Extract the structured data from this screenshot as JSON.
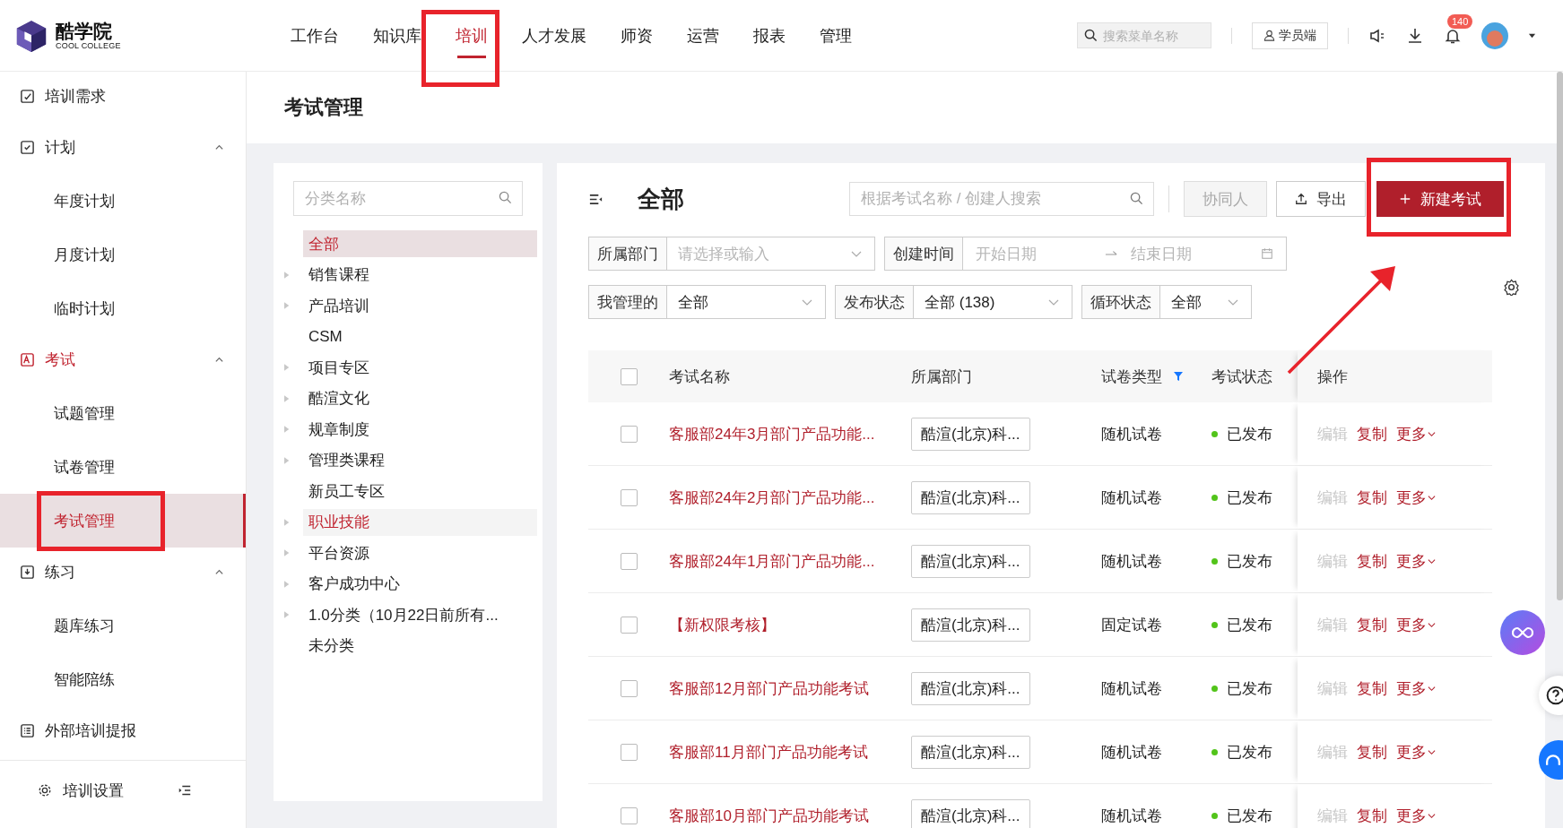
{
  "logo": {
    "name": "酷学院",
    "subtitle": "COOL COLLEGE"
  },
  "nav": [
    {
      "label": "工作台",
      "selected": false
    },
    {
      "label": "知识库",
      "selected": false
    },
    {
      "label": "培训",
      "selected": true
    },
    {
      "label": "人才发展",
      "selected": false
    },
    {
      "label": "师资",
      "selected": false
    },
    {
      "label": "运营",
      "selected": false
    },
    {
      "label": "报表",
      "selected": false
    },
    {
      "label": "管理",
      "selected": false
    }
  ],
  "menu_search": {
    "placeholder": "搜索菜单名称"
  },
  "student_button": "学员端",
  "notification_count": "140",
  "sidebar": {
    "items": [
      {
        "label": "培训需求"
      },
      {
        "label": "计划",
        "expanded": true,
        "children": [
          {
            "label": "年度计划",
            "selected": false
          },
          {
            "label": "月度计划",
            "selected": false
          },
          {
            "label": "临时计划",
            "selected": false
          }
        ]
      },
      {
        "label": "考试",
        "expanded": true,
        "children": [
          {
            "label": "试题管理",
            "selected": false
          },
          {
            "label": "试卷管理",
            "selected": false
          },
          {
            "label": "考试管理",
            "selected": true
          }
        ]
      },
      {
        "label": "练习",
        "expanded": true,
        "children": [
          {
            "label": "题库练习",
            "selected": false
          },
          {
            "label": "智能陪练",
            "selected": false
          }
        ]
      },
      {
        "label": "外部培训提报"
      }
    ],
    "footer": "培训设置"
  },
  "page_title": "考试管理",
  "categories": {
    "search_placeholder": "分类名称",
    "items": [
      {
        "label": "全部",
        "expandable": false,
        "selected": true,
        "hovered": false
      },
      {
        "label": "销售课程",
        "expandable": true,
        "selected": false,
        "hovered": false
      },
      {
        "label": "产品培训",
        "expandable": true,
        "selected": false,
        "hovered": false
      },
      {
        "label": "CSM",
        "expandable": false,
        "selected": false,
        "hovered": false
      },
      {
        "label": "项目专区",
        "expandable": true,
        "selected": false,
        "hovered": false
      },
      {
        "label": "酷渲文化",
        "expandable": true,
        "selected": false,
        "hovered": false
      },
      {
        "label": "规章制度",
        "expandable": true,
        "selected": false,
        "hovered": false
      },
      {
        "label": "管理类课程",
        "expandable": true,
        "selected": false,
        "hovered": false
      },
      {
        "label": "新员工专区",
        "expandable": false,
        "selected": false,
        "hovered": false
      },
      {
        "label": "职业技能",
        "expandable": true,
        "selected": false,
        "hovered": true
      },
      {
        "label": "平台资源",
        "expandable": true,
        "selected": false,
        "hovered": false
      },
      {
        "label": "客户成功中心",
        "expandable": true,
        "selected": false,
        "hovered": false
      },
      {
        "label": "1.0分类（10月22日前所有...",
        "expandable": true,
        "selected": false,
        "hovered": false
      },
      {
        "label": "未分类",
        "expandable": false,
        "selected": false,
        "hovered": false
      }
    ]
  },
  "main": {
    "title": "全部",
    "search_placeholder": "根据考试名称 / 创建人搜索",
    "buttons": [
      {
        "label": "协同人",
        "kind": "plain",
        "disabled": true
      },
      {
        "label": "导出",
        "kind": "export",
        "disabled": false
      },
      {
        "label": "新建考试",
        "kind": "primary",
        "disabled": false
      }
    ],
    "filter_rows": [
      [
        {
          "label": "所属部门",
          "kind": "select",
          "placeholder": "请选择或输入"
        },
        {
          "label": "创建时间",
          "kind": "daterange",
          "start_placeholder": "开始日期",
          "end_placeholder": "结束日期"
        }
      ],
      [
        {
          "label": "我管理的",
          "kind": "select",
          "value": "全部"
        },
        {
          "label": "发布状态",
          "kind": "select",
          "value": "全部 (138)"
        },
        {
          "label": "循环状态",
          "kind": "select",
          "value": "全部"
        }
      ]
    ]
  },
  "table": {
    "select_all_checked": false,
    "columns": [
      {
        "label": "考试名称",
        "filter": false
      },
      {
        "label": "所属部门",
        "filter": false
      },
      {
        "label": "试卷类型",
        "filter": true
      },
      {
        "label": "考试状态",
        "filter": false
      },
      {
        "label": "操作",
        "filter": false
      }
    ],
    "rows": [
      {
        "checked": false,
        "name": "客服部24年3月部门产品功能...",
        "department": "酷渲(北京)科...",
        "paper_type": "随机试卷",
        "status": "已发布",
        "color": "#52c41a",
        "actions": [
          {
            "label": "编辑",
            "disabled": true
          },
          {
            "label": "复制",
            "disabled": false
          },
          {
            "label": "更多",
            "disabled": false
          }
        ]
      },
      {
        "checked": false,
        "name": "客服部24年2月部门产品功能...",
        "department": "酷渲(北京)科...",
        "paper_type": "随机试卷",
        "status": "已发布",
        "color": "#52c41a",
        "actions": [
          {
            "label": "编辑",
            "disabled": true
          },
          {
            "label": "复制",
            "disabled": false
          },
          {
            "label": "更多",
            "disabled": false
          }
        ]
      },
      {
        "checked": false,
        "name": "客服部24年1月部门产品功能...",
        "department": "酷渲(北京)科...",
        "paper_type": "随机试卷",
        "status": "已发布",
        "color": "#52c41a",
        "actions": [
          {
            "label": "编辑",
            "disabled": true
          },
          {
            "label": "复制",
            "disabled": false
          },
          {
            "label": "更多",
            "disabled": false
          }
        ]
      },
      {
        "checked": false,
        "name": "【新权限考核】",
        "department": "酷渲(北京)科...",
        "paper_type": "固定试卷",
        "status": "已发布",
        "color": "#52c41a",
        "actions": [
          {
            "label": "编辑",
            "disabled": true
          },
          {
            "label": "复制",
            "disabled": false
          },
          {
            "label": "更多",
            "disabled": false
          }
        ]
      },
      {
        "checked": false,
        "name": "客服部12月部门产品功能考试",
        "department": "酷渲(北京)科...",
        "paper_type": "随机试卷",
        "status": "已发布",
        "color": "#52c41a",
        "actions": [
          {
            "label": "编辑",
            "disabled": true
          },
          {
            "label": "复制",
            "disabled": false
          },
          {
            "label": "更多",
            "disabled": false
          }
        ]
      },
      {
        "checked": false,
        "name": "客服部11月部门产品功能考试",
        "department": "酷渲(北京)科...",
        "paper_type": "随机试卷",
        "status": "已发布",
        "color": "#52c41a",
        "actions": [
          {
            "label": "编辑",
            "disabled": true
          },
          {
            "label": "复制",
            "disabled": false
          },
          {
            "label": "更多",
            "disabled": false
          }
        ]
      },
      {
        "checked": false,
        "name": "客服部10月部门产品功能考试",
        "department": "酷渲(北京)科...",
        "paper_type": "随机试卷",
        "status": "已发布",
        "color": "#52c41a",
        "actions": [
          {
            "label": "编辑",
            "disabled": true
          },
          {
            "label": "复制",
            "disabled": false
          },
          {
            "label": "更多",
            "disabled": false
          }
        ]
      }
    ]
  }
}
